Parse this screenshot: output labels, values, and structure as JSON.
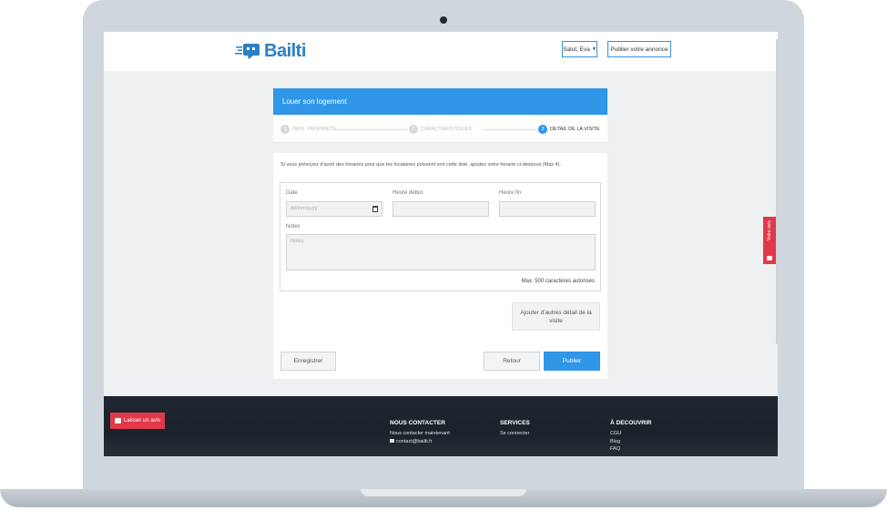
{
  "header": {
    "brand": "Bailti",
    "user_menu": "Salut, Eva",
    "publish_link": "Publier votre annonce"
  },
  "feedback_tab": {
    "label": "Votre avis"
  },
  "card": {
    "title": "Louer son logement",
    "steps": [
      {
        "num": "1",
        "label": "INFO. PROPRIETE"
      },
      {
        "num": "2",
        "label": "CARACTERISTIQUES"
      },
      {
        "num": "3",
        "label": "DETAIL DE LA VISITE"
      }
    ]
  },
  "form": {
    "intro": "Si vous prévoyez d'avoir des horaires pour que les locataires puissent voir cette liste, ajoutez votre horaire ci-dessous (Max 4).",
    "date_label": "Date",
    "date_placeholder": "dd/mm/yyyy",
    "start_label": "Heure début",
    "end_label": "Heure fin",
    "notes_label": "Notes",
    "notes_placeholder": "Notes",
    "counter": "Max. 500 caractères autorisés",
    "add_button": "Ajouter d'autres détail de la visite",
    "save_button": "Enregistrer",
    "back_button": "Retour",
    "publish_button": "Publier"
  },
  "footer": {
    "review_button": "Laisser un avis",
    "contact": {
      "heading": "NOUS CONTACTER",
      "line1": "Nous contacter maintenant",
      "email": "contact@bailti.fr"
    },
    "services": {
      "heading": "SERVICES",
      "line1": "Se connecter"
    },
    "discover": {
      "heading": "À DECOUVRIR",
      "links": [
        "CGU",
        "Blog",
        "FAQ"
      ]
    }
  },
  "colors": {
    "primary": "#2f96e8",
    "accent": "#e2394a",
    "footer": "#1f2630"
  }
}
